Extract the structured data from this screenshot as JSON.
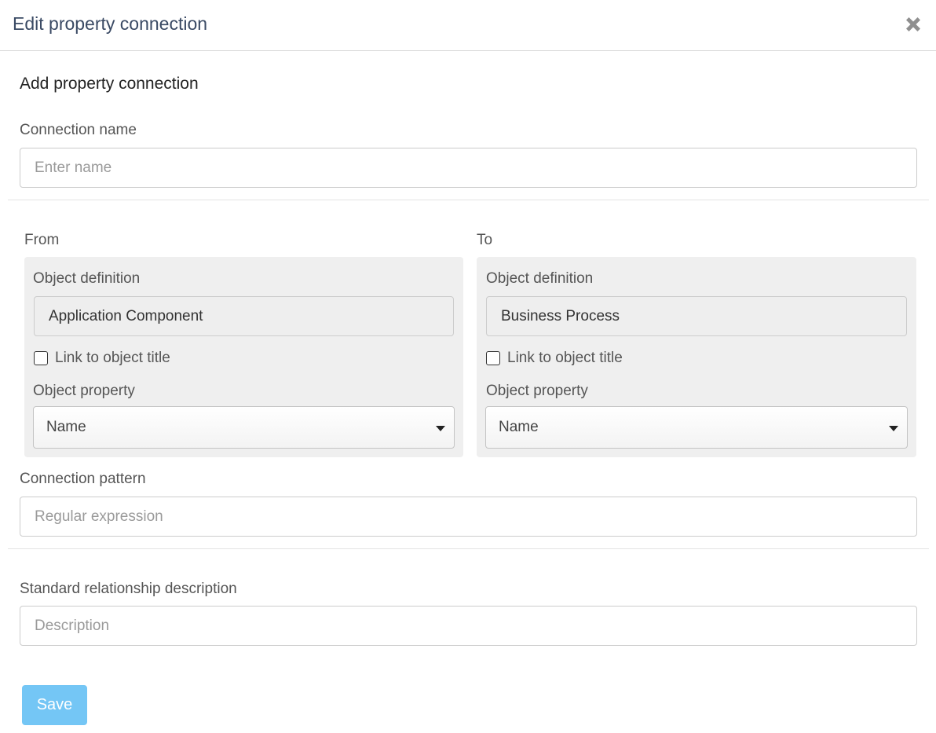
{
  "dialog": {
    "title": "Edit property connection",
    "close_icon": "close-icon"
  },
  "form": {
    "section_title": "Add property connection",
    "connection_name": {
      "label": "Connection name",
      "value": "",
      "placeholder": "Enter name"
    },
    "from": {
      "heading": "From",
      "object_definition_label": "Object definition",
      "object_definition_value": "Application Component",
      "link_checkbox_label": "Link to object title",
      "link_checked": false,
      "object_property_label": "Object property",
      "object_property_value": "Name"
    },
    "to": {
      "heading": "To",
      "object_definition_label": "Object definition",
      "object_definition_value": "Business Process",
      "link_checkbox_label": "Link to object title",
      "link_checked": false,
      "object_property_label": "Object property",
      "object_property_value": "Name"
    },
    "connection_pattern": {
      "label": "Connection pattern",
      "value": "",
      "placeholder": "Regular expression"
    },
    "relationship_description": {
      "label": "Standard relationship description",
      "value": "",
      "placeholder": "Description"
    },
    "save_label": "Save"
  },
  "colors": {
    "save_button": "#74c6f5",
    "title_text": "#3a4a64",
    "panel_background": "#efefef"
  }
}
